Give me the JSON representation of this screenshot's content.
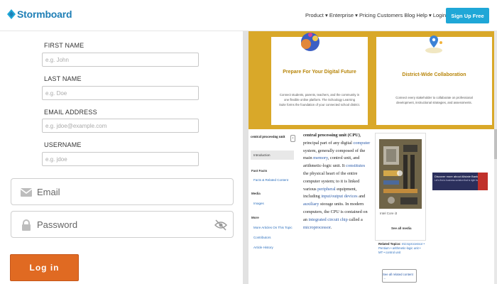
{
  "header": {
    "logo": "Stormboard",
    "nav": [
      "Product",
      "Enterprise",
      "Pricing",
      "Customers",
      "Blog",
      "Help",
      "Login"
    ],
    "signup": "Sign Up Free"
  },
  "form": {
    "first_name": {
      "label": "FIRST NAME",
      "placeholder": "e.g. John"
    },
    "last_name": {
      "label": "LAST NAME",
      "placeholder": "e.g. Doe"
    },
    "email_address": {
      "label": "EMAIL ADDRESS",
      "placeholder": "e.g. jdoe@example.com"
    },
    "username": {
      "label": "USERNAME",
      "placeholder": "e.g. jdoe"
    }
  },
  "login_form": {
    "email_placeholder": "Email",
    "password_placeholder": "Password",
    "login_button": "Log in"
  },
  "cards": [
    {
      "title": "Prepare For Your Digital Future",
      "text": [
        "Connect students, parents, teachers, and the community in",
        "one flexible online platform. The Schoology Learning",
        "Suite forms the foundation of your connected school district."
      ]
    },
    {
      "title": "District-Wide Collaboration",
      "text": [
        "Connect every stakeholder to collaborate on professional",
        "development, instructional strategies, and assessments."
      ]
    }
  ],
  "article": {
    "sidebar_title": "central processing unit",
    "sidebar_selected": "Introduction",
    "fact_heading": "Fast Facts",
    "fact_link": "Facts & Related Content",
    "media_heading": "Media",
    "media_link": "Images",
    "more_heading": "More",
    "more_links": [
      "More Articles On This Topic",
      "Contributors",
      "Article History"
    ],
    "body": {
      "term": "central processing unit (CPU)",
      "p1": ", principal part of any digital ",
      "link1": "computer",
      "p2": " system, generally composed of the main ",
      "link2": "memory",
      "p3": ", control unit, and arithmetic-logic unit. It ",
      "link3": "constitutes",
      "p4": " the physical heart of the entire computer system; to it is linked various ",
      "link4": "peripheral",
      "p5": " equipment, including ",
      "link5": "input/output devices",
      "p6": " and ",
      "link6": "auxiliary",
      "p7": " storage units. In modern computers, the CPU is contained on an ",
      "link7": "integrated circuit chip",
      "p8": " called a ",
      "link8": "microprocessor",
      "p9": "."
    },
    "media_caption": "Intel Core i3",
    "see_all_media": "See all media",
    "related_label": "Related Topics:",
    "related_text": "microprocessor • Pentium • arithmetic-logic unit • MT • control unit",
    "see_all_related": "See all related content →"
  },
  "ad": {
    "line1": "Discover more about Allstate Bank",
    "line2": "Let's find a business solution that is right for you"
  },
  "colors": {
    "brand": "#1f7fb6",
    "signup": "#1fa7d7",
    "login": "#e06a22",
    "cards_bg": "#d9a829"
  }
}
